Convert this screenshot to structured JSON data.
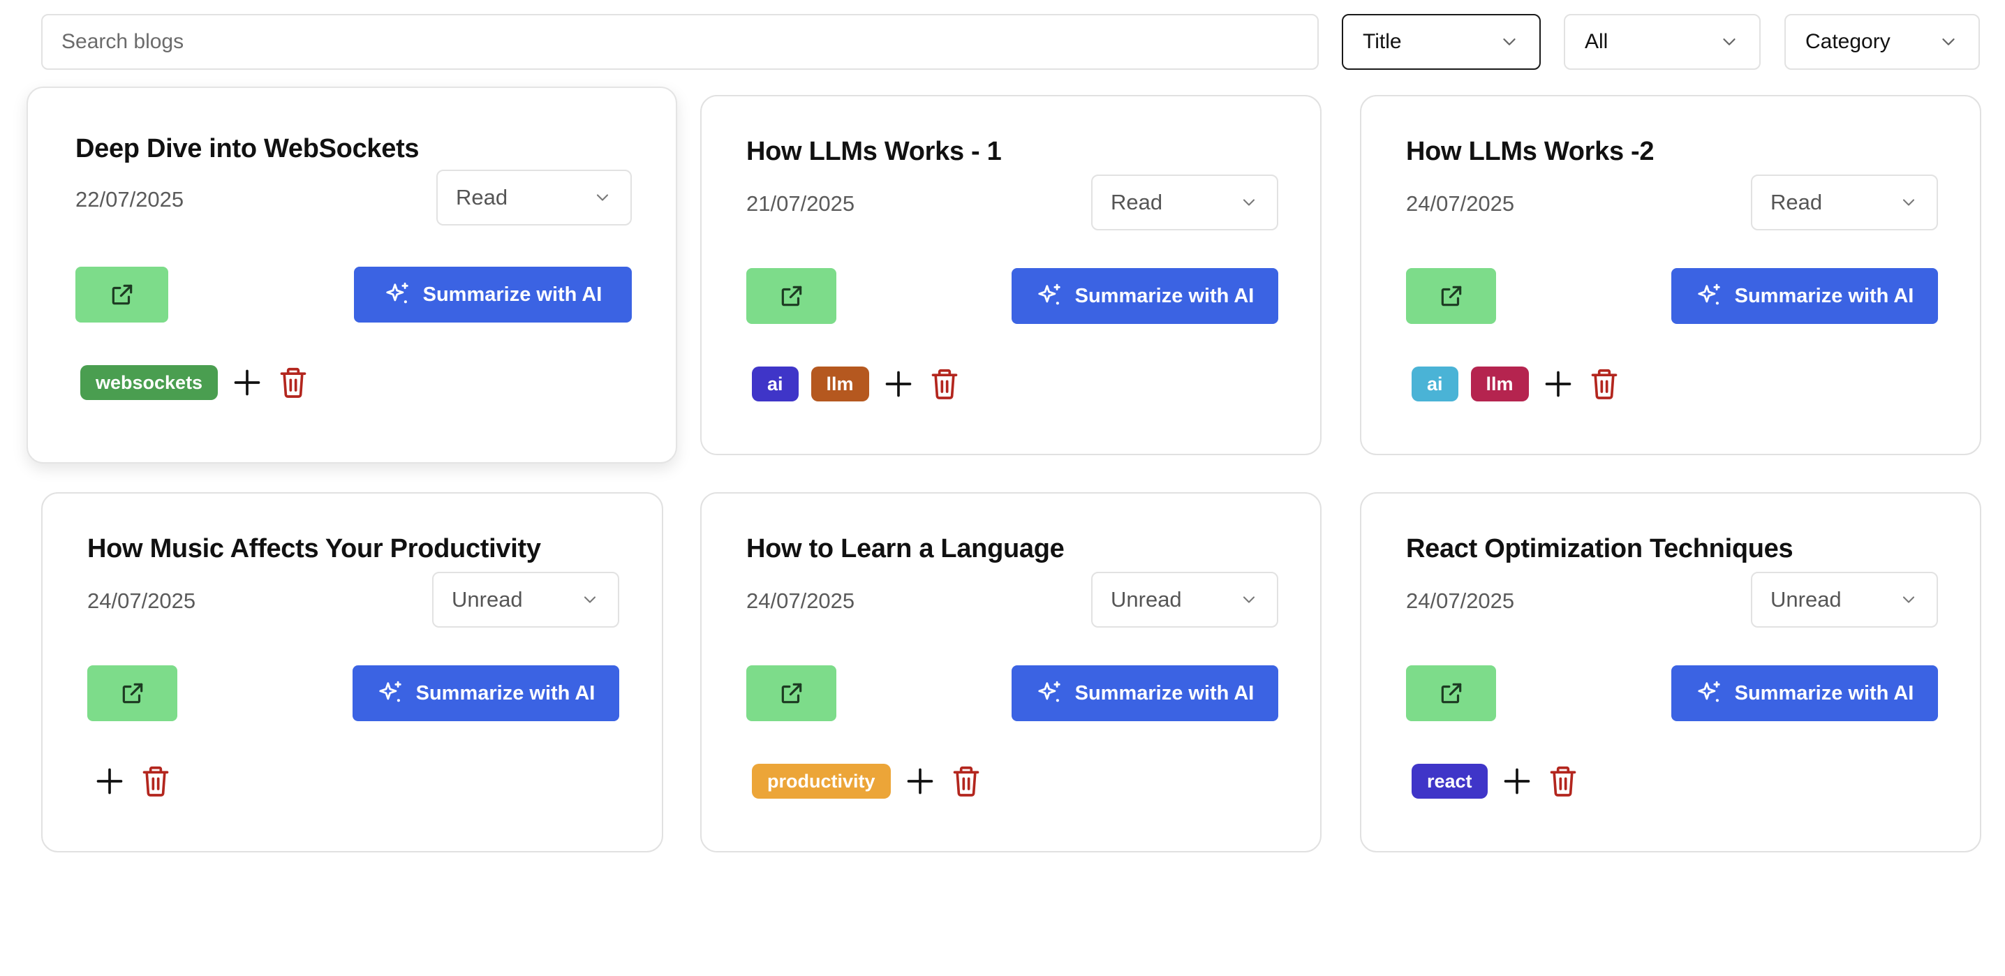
{
  "toolbar": {
    "search_placeholder": "Search blogs",
    "sort_field": "Title",
    "status_filter": "All",
    "category_filter": "Category"
  },
  "colors": {
    "accent_blue": "#3b63e3",
    "open_green": "#7ddc8a",
    "delete_red": "#b3261e"
  },
  "blogs": [
    {
      "title": "Deep Dive into WebSockets",
      "date": "22/07/2025",
      "status": "Read",
      "summarize_label": "Summarize with AI",
      "tags": [
        {
          "name": "websockets",
          "color": "#4a9e50"
        }
      ]
    },
    {
      "title": "How LLMs Works - 1",
      "date": "21/07/2025",
      "status": "Read",
      "summarize_label": "Summarize with AI",
      "tags": [
        {
          "name": "ai",
          "color": "#3f35c8"
        },
        {
          "name": "llm",
          "color": "#b5581f"
        }
      ]
    },
    {
      "title": "How LLMs Works -2",
      "date": "24/07/2025",
      "status": "Read",
      "summarize_label": "Summarize with AI",
      "tags": [
        {
          "name": "ai",
          "color": "#4ab3d6"
        },
        {
          "name": "llm",
          "color": "#b5244f"
        }
      ]
    },
    {
      "title": "How Music Affects Your Productivity",
      "date": "24/07/2025",
      "status": "Unread",
      "summarize_label": "Summarize with AI",
      "tags": []
    },
    {
      "title": "How to Learn a Language",
      "date": "24/07/2025",
      "status": "Unread",
      "summarize_label": "Summarize with AI",
      "tags": [
        {
          "name": "productivity",
          "color": "#eca538"
        }
      ]
    },
    {
      "title": "React Optimization Techniques",
      "date": "24/07/2025",
      "status": "Unread",
      "summarize_label": "Summarize with AI",
      "tags": [
        {
          "name": "react",
          "color": "#3f35c8"
        }
      ]
    }
  ]
}
